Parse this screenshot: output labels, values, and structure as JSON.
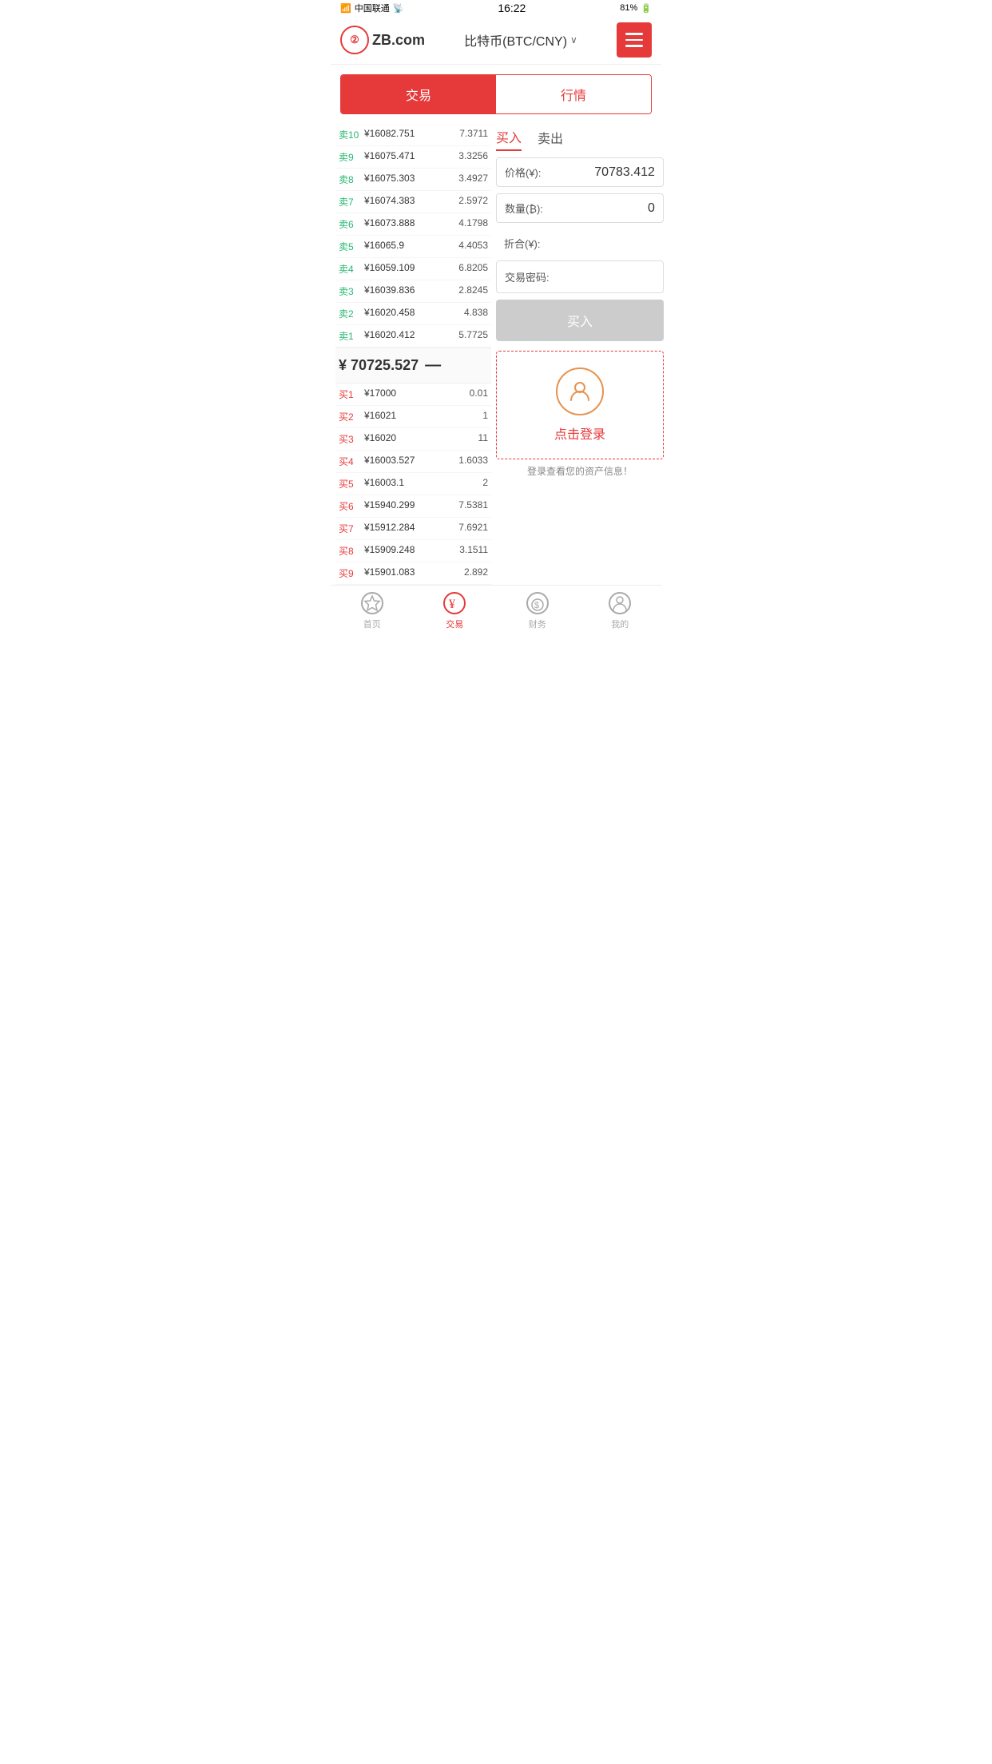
{
  "status": {
    "carrier": "中国联通",
    "time": "16:22",
    "battery": "81%"
  },
  "header": {
    "logo": "ZB",
    "logo_suffix": ".com",
    "title": "比特币(BTC/CNY)",
    "menu_icon": "≡"
  },
  "tabs_top": {
    "tab1": "交易",
    "tab2": "行情"
  },
  "sell_orders": [
    {
      "label": "卖10",
      "price": "¥16082.751",
      "qty": "7.3711"
    },
    {
      "label": "卖9",
      "price": "¥16075.471",
      "qty": "3.3256"
    },
    {
      "label": "卖8",
      "price": "¥16075.303",
      "qty": "3.4927"
    },
    {
      "label": "卖7",
      "price": "¥16074.383",
      "qty": "2.5972"
    },
    {
      "label": "卖6",
      "price": "¥16073.888",
      "qty": "4.1798"
    },
    {
      "label": "卖5",
      "price": "¥16065.9",
      "qty": "4.4053"
    },
    {
      "label": "卖4",
      "price": "¥16059.109",
      "qty": "6.8205"
    },
    {
      "label": "卖3",
      "price": "¥16039.836",
      "qty": "2.8245"
    },
    {
      "label": "卖2",
      "price": "¥16020.458",
      "qty": "4.838"
    },
    {
      "label": "卖1",
      "price": "¥16020.412",
      "qty": "5.7725"
    }
  ],
  "mid_price": {
    "value": "¥ 70725.527",
    "symbol": "—"
  },
  "buy_orders": [
    {
      "label": "买1",
      "price": "¥17000",
      "qty": "0.01"
    },
    {
      "label": "买2",
      "price": "¥16021",
      "qty": "1"
    },
    {
      "label": "买3",
      "price": "¥16020",
      "qty": "11"
    },
    {
      "label": "买4",
      "price": "¥16003.527",
      "qty": "1.6033"
    },
    {
      "label": "买5",
      "price": "¥16003.1",
      "qty": "2"
    },
    {
      "label": "买6",
      "price": "¥15940.299",
      "qty": "7.5381"
    },
    {
      "label": "买7",
      "price": "¥15912.284",
      "qty": "7.6921"
    },
    {
      "label": "买8",
      "price": "¥15909.248",
      "qty": "3.1511"
    },
    {
      "label": "买9",
      "price": "¥15901.083",
      "qty": "2.892"
    }
  ],
  "trade_panel": {
    "buy_tab": "买入",
    "sell_tab": "卖出",
    "price_label": "价格(¥):",
    "price_value": "70783.412",
    "qty_label": "数量(₿):",
    "qty_value": "0",
    "total_label": "折合(¥):",
    "total_value": "",
    "pwd_label": "交易密码:",
    "buy_btn": "买入",
    "login_hint": "登录查看您的资产信息！",
    "login_btn": "点击登录"
  },
  "bottom_nav": [
    {
      "label": "首页",
      "icon": "★",
      "active": false
    },
    {
      "label": "交易",
      "icon": "¥",
      "active": true
    },
    {
      "label": "财务",
      "icon": "$",
      "active": false
    },
    {
      "label": "我的",
      "icon": "👤",
      "active": false
    }
  ]
}
